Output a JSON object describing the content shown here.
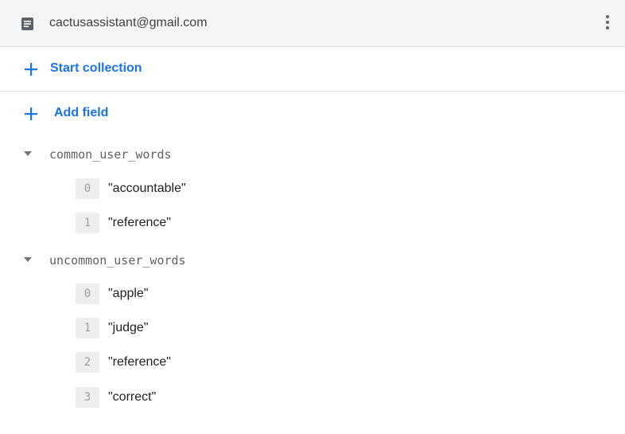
{
  "document": {
    "title": "cactusassistant@gmail.com"
  },
  "actions": {
    "start_collection": "Start collection",
    "add_field": "Add field"
  },
  "fields": [
    {
      "name": "common_user_words",
      "items": [
        {
          "index": "0",
          "value": "\"accountable\""
        },
        {
          "index": "1",
          "value": "\"reference\""
        }
      ]
    },
    {
      "name": "uncommon_user_words",
      "items": [
        {
          "index": "0",
          "value": "\"apple\""
        },
        {
          "index": "1",
          "value": "\"judge\""
        },
        {
          "index": "2",
          "value": "\"reference\""
        },
        {
          "index": "3",
          "value": "\"correct\""
        }
      ]
    }
  ],
  "colors": {
    "accent": "#1a73e8",
    "header_bg": "#f5f5f5",
    "divider": "#dadce0",
    "badge_bg": "#eeeeee",
    "badge_text": "#9e9e9e",
    "field_text": "#5f6368"
  },
  "icons": {
    "document": "document-icon",
    "menu": "more-vert-icon",
    "add": "plus-icon",
    "expand": "caret-down-icon"
  }
}
